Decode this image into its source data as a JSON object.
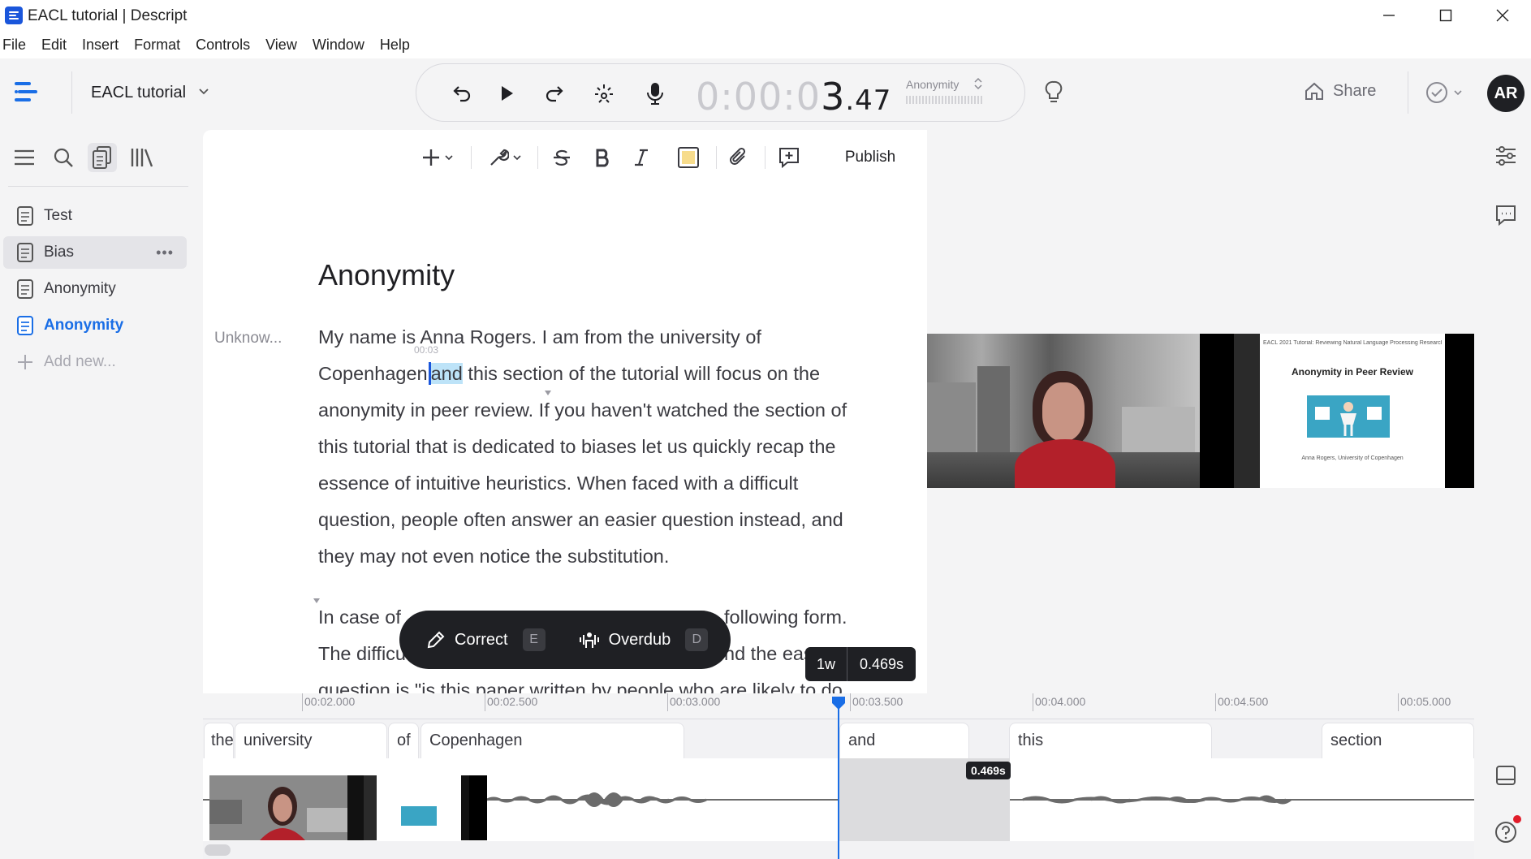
{
  "window": {
    "title": "EACL tutorial | Descript",
    "controls": [
      "minimize",
      "maximize",
      "close"
    ]
  },
  "menu": [
    "File",
    "Edit",
    "Insert",
    "Format",
    "Controls",
    "View",
    "Window",
    "Help"
  ],
  "topbar": {
    "project_title": "EACL tutorial",
    "timecode": {
      "dim": "0:00:0",
      "bright": "3",
      "ms": ".47"
    },
    "scene": "Anonymity",
    "share_label": "Share",
    "avatar_initials": "AR"
  },
  "sidebar": {
    "documents": [
      {
        "label": "Test",
        "state": "normal"
      },
      {
        "label": "Bias",
        "state": "selected"
      },
      {
        "label": "Anonymity",
        "state": "normal"
      },
      {
        "label": "Anonymity",
        "state": "active"
      }
    ],
    "add_new_label": "Add new...",
    "more_glyph": "•••"
  },
  "editor": {
    "toolbar": {
      "publish_label": "Publish"
    },
    "doc_title": "Anonymity",
    "speaker": "Unknow...",
    "mini_timestamp": "00:03",
    "para1": {
      "line1": "My name is Anna Rogers. I am from the university of",
      "l2_before": "Copenhagen",
      "l2_highlight": "and",
      "l2_after": " this section of the tutorial will focus on the",
      "line3": "anonymity in peer review.  If you haven't watched the section of",
      "line4": "this tutorial that is dedicated to biases let us quickly recap the",
      "line5": "essence of intuitive heuristics. When faced with a difficult",
      "line6": "question, people often answer an easier question instead, and",
      "line7": "they may not even notice the substitution."
    },
    "para2": {
      "l1_start": "In case of ",
      "l1_end": "following form.",
      "l2_start": "The difficu",
      "l2_end": "nd the eas",
      "l3": "question is  \"is this paper written by people who are likely to do"
    },
    "float_bar": {
      "correct_label": "Correct",
      "correct_key": "E",
      "overdub_label": "Overdub",
      "overdub_key": "D"
    },
    "word_badge": {
      "count": "1w",
      "duration": "0.469s"
    }
  },
  "video": {
    "slide_header": "EACL 2021 Tutorial: Reviewing Natural Language Processing Research",
    "slide_title": "Anonymity in Peer Review",
    "slide_author": "Anna Rogers, University of Copenhagen"
  },
  "timeline": {
    "ticks": [
      "00:02.000",
      "00:02.500",
      "00:03.000",
      "00:03.500",
      "00:04.000",
      "00:04.500",
      "00:05.000"
    ],
    "words": [
      "the",
      "university",
      "of",
      "Copenhagen",
      "and",
      "this",
      "section"
    ],
    "selection_duration": "0.469s"
  }
}
